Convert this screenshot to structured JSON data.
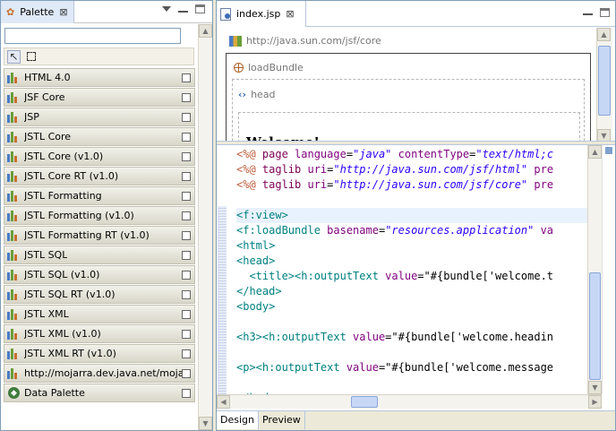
{
  "palette": {
    "title": "Palette",
    "close": "⊠",
    "search": {
      "value": "",
      "placeholder": ""
    },
    "drawers": [
      "HTML 4.0",
      "JSF Core",
      "JSP",
      "JSTL Core",
      "JSTL Core (v1.0)",
      "JSTL Core RT (v1.0)",
      "JSTL Formatting",
      "JSTL Formatting (v1.0)",
      "JSTL Formatting RT (v1.0)",
      "JSTL SQL",
      "JSTL SQL (v1.0)",
      "JSTL SQL RT (v1.0)",
      "JSTL XML",
      "JSTL XML (v1.0)",
      "JSTL XML RT (v1.0)",
      "http://mojarra.dev.java.net/mojarra...",
      "Data Palette"
    ]
  },
  "editor": {
    "tab_title": "index.jsp",
    "close": "⊠",
    "design": {
      "taglib_uri": "http://java.sun.com/jsf/core",
      "loadbundle_label": "loadBundle",
      "head_label": "head",
      "h3_preview": "Welcome!"
    },
    "source_lines": [
      [
        [
          "d",
          "<%@ "
        ],
        [
          "k",
          "page "
        ],
        [
          "a",
          "language"
        ],
        [
          "tx",
          "="
        ],
        [
          "s",
          "\"java\" "
        ],
        [
          "a",
          "contentType"
        ],
        [
          "tx",
          "="
        ],
        [
          "s",
          "\"text/html;c"
        ]
      ],
      [
        [
          "d",
          "<%@ "
        ],
        [
          "k",
          "taglib "
        ],
        [
          "a",
          "uri"
        ],
        [
          "tx",
          "="
        ],
        [
          "s",
          "\"http://java.sun.com/jsf/html\" "
        ],
        [
          "a",
          "pre"
        ]
      ],
      [
        [
          "d",
          "<%@ "
        ],
        [
          "k",
          "taglib "
        ],
        [
          "a",
          "uri"
        ],
        [
          "tx",
          "="
        ],
        [
          "s",
          "\"http://java.sun.com/jsf/core\" "
        ],
        [
          "a",
          "pre"
        ]
      ],
      [],
      [
        [
          "t",
          "<f:view>"
        ]
      ],
      [
        [
          "t",
          "<f:loadBundle "
        ],
        [
          "a",
          "basename"
        ],
        [
          "tx",
          "="
        ],
        [
          "s",
          "\"resources.application\" "
        ],
        [
          "a",
          "va"
        ]
      ],
      [
        [
          "t",
          "<html>"
        ]
      ],
      [
        [
          "t",
          "<head>"
        ]
      ],
      [
        [
          "tx",
          "  "
        ],
        [
          "t",
          "<title><h:outputText "
        ],
        [
          "a",
          "value"
        ],
        [
          "tx",
          "=\"#{bundle['welcome.t"
        ]
      ],
      [
        [
          "t",
          "</head>"
        ]
      ],
      [
        [
          "t",
          "<body>"
        ]
      ],
      [],
      [
        [
          "t",
          "<h3><h:outputText "
        ],
        [
          "a",
          "value"
        ],
        [
          "tx",
          "=\"#{bundle['welcome.headin"
        ]
      ],
      [],
      [
        [
          "t",
          "<p><h:outputText "
        ],
        [
          "a",
          "value"
        ],
        [
          "tx",
          "=\"#{bundle['welcome.message"
        ]
      ],
      [],
      [
        [
          "t",
          "</body>"
        ]
      ]
    ],
    "bottom_tabs": [
      "Design",
      "Preview"
    ]
  },
  "colors": {
    "tag": "#008080",
    "directive": "#bf5f3f",
    "keyword": "#7f0055",
    "attribute": "#7f007f",
    "string": "#2a00ff"
  }
}
